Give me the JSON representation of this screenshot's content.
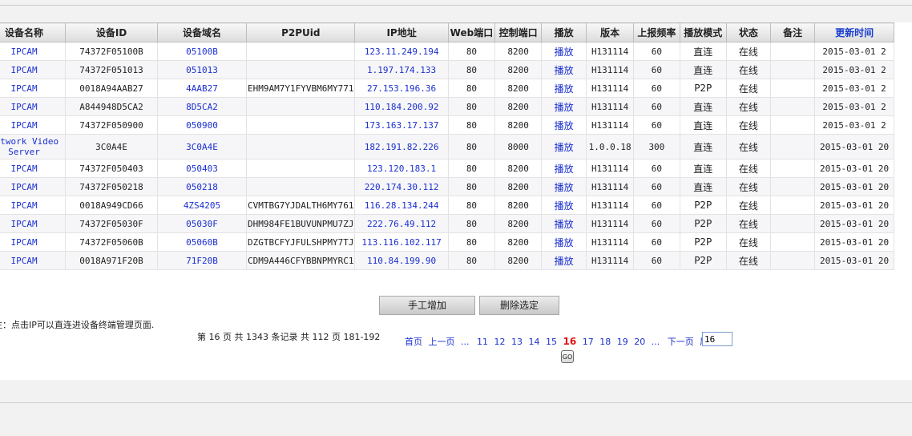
{
  "table": {
    "headers": [
      "设备名称",
      "设备ID",
      "设备域名",
      "P2PUid",
      "IP地址",
      "Web端口",
      "控制端口",
      "播放",
      "版本",
      "上报频率",
      "播放模式",
      "状态",
      "备注",
      "更新时间"
    ],
    "rows": [
      {
        "name": "IPCAM",
        "id": "74372F05100B",
        "domain": "05100B",
        "p2puid": "",
        "ip": "123.11.249.194",
        "web_port": "80",
        "ctrl_port": "8200",
        "play": "播放",
        "version": "H131114",
        "freq": "60",
        "mode": "直连",
        "status": "在线",
        "note": "",
        "updated": "2015-03-01 2"
      },
      {
        "name": "IPCAM",
        "id": "74372F051013",
        "domain": "051013",
        "p2puid": "",
        "ip": "1.197.174.133",
        "web_port": "80",
        "ctrl_port": "8200",
        "play": "播放",
        "version": "H131114",
        "freq": "60",
        "mode": "直连",
        "status": "在线",
        "note": "",
        "updated": "2015-03-01 2"
      },
      {
        "name": "IPCAM",
        "id": "0018A94AAB27",
        "domain": "4AAB27",
        "p2puid": "EHM9AM7Y1FYVBM6MY771",
        "ip": "27.153.196.36",
        "web_port": "80",
        "ctrl_port": "8200",
        "play": "播放",
        "version": "H131114",
        "freq": "60",
        "mode": "P2P",
        "status": "在线",
        "note": "",
        "updated": "2015-03-01 2"
      },
      {
        "name": "IPCAM",
        "id": "A844948D5CA2",
        "domain": "8D5CA2",
        "p2puid": "",
        "ip": "110.184.200.92",
        "web_port": "80",
        "ctrl_port": "8200",
        "play": "播放",
        "version": "H131114",
        "freq": "60",
        "mode": "直连",
        "status": "在线",
        "note": "",
        "updated": "2015-03-01 2"
      },
      {
        "name": "IPCAM",
        "id": "74372F050900",
        "domain": "050900",
        "p2puid": "",
        "ip": "173.163.17.137",
        "web_port": "80",
        "ctrl_port": "8200",
        "play": "播放",
        "version": "H131114",
        "freq": "60",
        "mode": "直连",
        "status": "在线",
        "note": "",
        "updated": "2015-03-01 2"
      },
      {
        "name": "Network Video Server",
        "id": "3C0A4E",
        "domain": "3C0A4E",
        "p2puid": "",
        "ip": "182.191.82.226",
        "web_port": "80",
        "ctrl_port": "8000",
        "play": "播放",
        "version": "1.0.0.18",
        "freq": "300",
        "mode": "直连",
        "status": "在线",
        "note": "",
        "updated": "2015-03-01 20"
      },
      {
        "name": "IPCAM",
        "id": "74372F050403",
        "domain": "050403",
        "p2puid": "",
        "ip": "123.120.183.1",
        "web_port": "80",
        "ctrl_port": "8200",
        "play": "播放",
        "version": "H131114",
        "freq": "60",
        "mode": "直连",
        "status": "在线",
        "note": "",
        "updated": "2015-03-01 20"
      },
      {
        "name": "IPCAM",
        "id": "74372F050218",
        "domain": "050218",
        "p2puid": "",
        "ip": "220.174.30.112",
        "web_port": "80",
        "ctrl_port": "8200",
        "play": "播放",
        "version": "H131114",
        "freq": "60",
        "mode": "直连",
        "status": "在线",
        "note": "",
        "updated": "2015-03-01 20"
      },
      {
        "name": "IPCAM",
        "id": "0018A949CD66",
        "domain": "4ZS4205",
        "p2puid": "CVMTBG7YJDALTH6MY761",
        "ip": "116.28.134.244",
        "web_port": "80",
        "ctrl_port": "8200",
        "play": "播放",
        "version": "H131114",
        "freq": "60",
        "mode": "P2P",
        "status": "在线",
        "note": "",
        "updated": "2015-03-01 20"
      },
      {
        "name": "IPCAM",
        "id": "74372F05030F",
        "domain": "05030F",
        "p2puid": "DHM984FE1BUVUNPMU7ZJ",
        "ip": "222.76.49.112",
        "web_port": "80",
        "ctrl_port": "8200",
        "play": "播放",
        "version": "H131114",
        "freq": "60",
        "mode": "P2P",
        "status": "在线",
        "note": "",
        "updated": "2015-03-01 20"
      },
      {
        "name": "IPCAM",
        "id": "74372F05060B",
        "domain": "05060B",
        "p2puid": "DZGTBCFYJFULSHPMY7TJ",
        "ip": "113.116.102.117",
        "web_port": "80",
        "ctrl_port": "8200",
        "play": "播放",
        "version": "H131114",
        "freq": "60",
        "mode": "P2P",
        "status": "在线",
        "note": "",
        "updated": "2015-03-01 20"
      },
      {
        "name": "IPCAM",
        "id": "0018A971F20B",
        "domain": "71F20B",
        "p2puid": "CDM9A446CFYBBNPMYRC1",
        "ip": "110.84.199.90",
        "web_port": "80",
        "ctrl_port": "8200",
        "play": "播放",
        "version": "H131114",
        "freq": "60",
        "mode": "P2P",
        "status": "在线",
        "note": "",
        "updated": "2015-03-01 20"
      }
    ]
  },
  "actions": {
    "add_label": "手工增加",
    "delete_label": "删除选定"
  },
  "note": "注：点击IP可以直连进设备终端管理页面.",
  "pagination": {
    "info": "第 16 页 共 1343 条记录 共 112 页 181-192",
    "first": "首页",
    "prev": "上一页",
    "ellipsis": "...",
    "pages": [
      "11",
      "12",
      "13",
      "14",
      "15",
      "16",
      "17",
      "18",
      "19",
      "20"
    ],
    "current": "16",
    "next": "下一页",
    "last": "尾页",
    "input_value": "16",
    "go_label": "GO"
  },
  "colors": {
    "link": "#1a2fcf",
    "current_page": "#e01010",
    "header_accent": "#1a3fd0"
  }
}
